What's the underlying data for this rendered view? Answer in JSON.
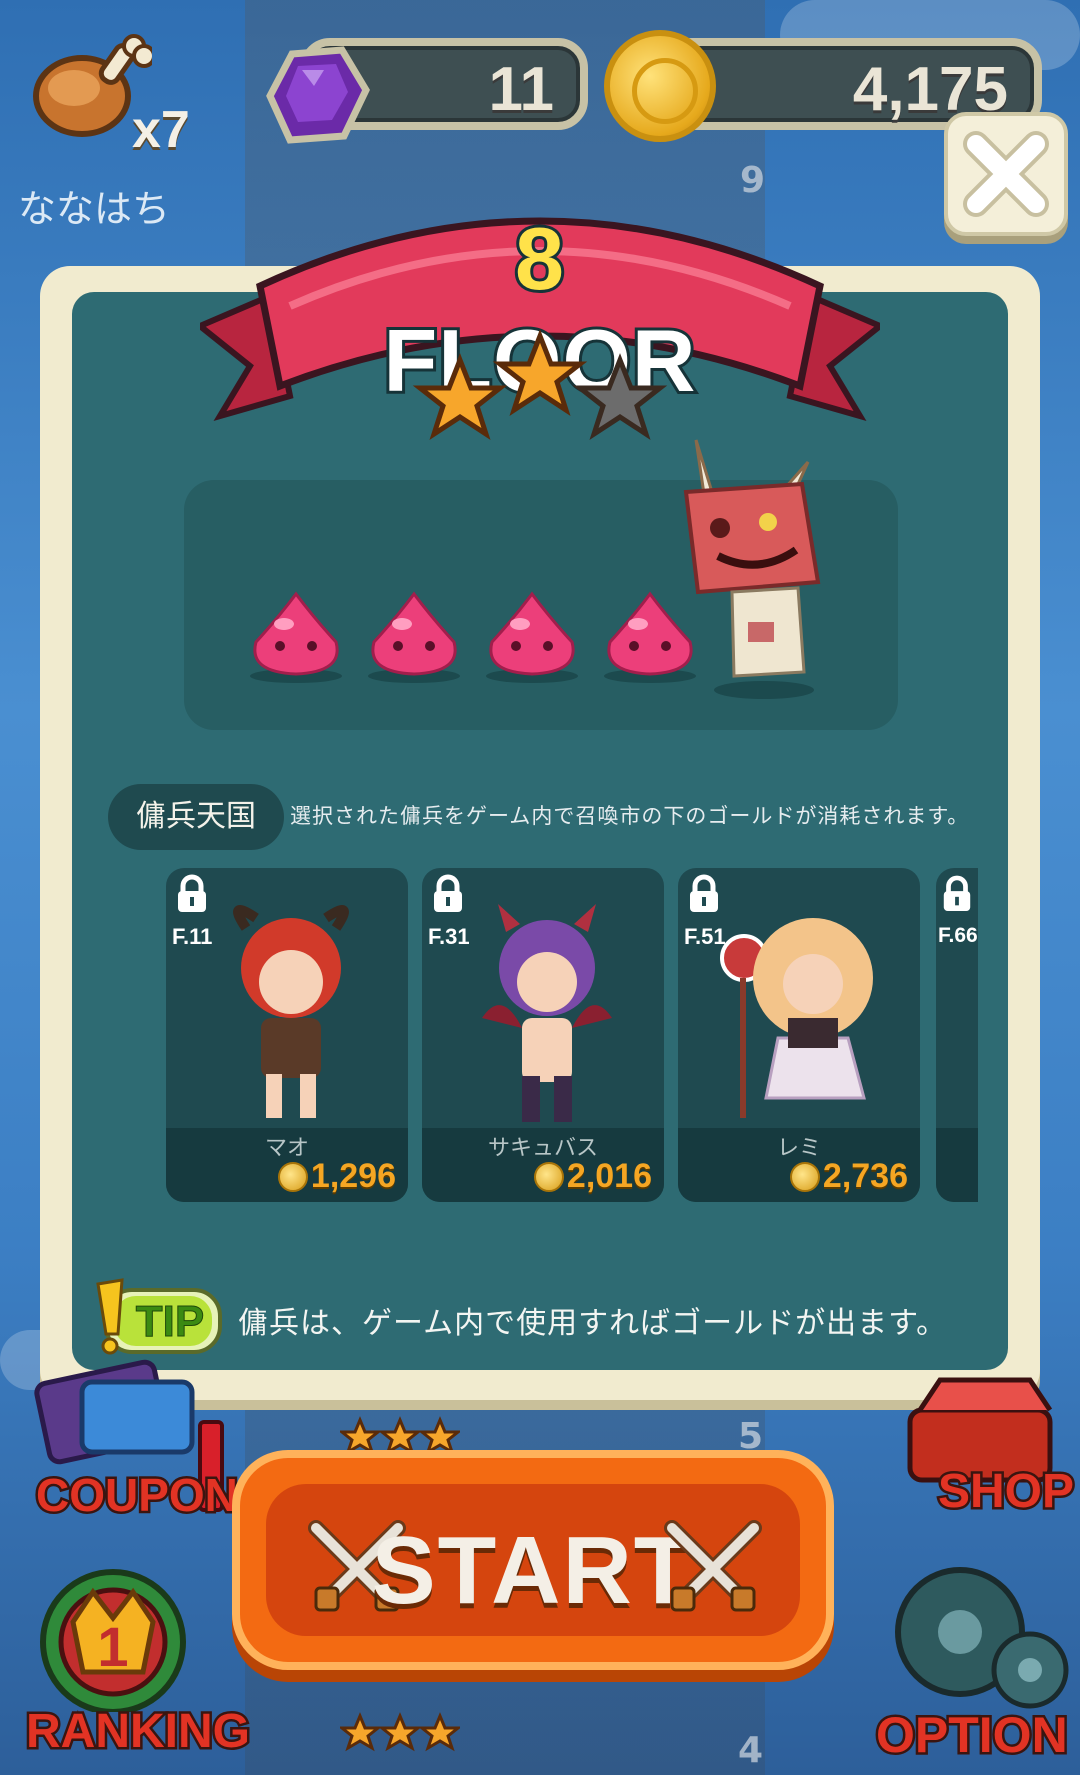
{
  "hud": {
    "meat_count": "x7",
    "player_name": "ななはち",
    "gems": "11",
    "gold": "4,175"
  },
  "background": {
    "floor_numbers": [
      "9",
      "5",
      "4"
    ]
  },
  "banner": {
    "floor_number": "8",
    "floor_label": "FLOOR",
    "stars_earned": 2,
    "stars_total": 3
  },
  "enemies": {
    "slime_count": 4,
    "boss": "boss-rabbit-mask"
  },
  "mercenary": {
    "label": "傭兵天国",
    "description": "選択された傭兵をゲーム内で召喚市の下のゴールドが消耗されます。",
    "cards": [
      {
        "floor": "F.11",
        "name": "マオ",
        "price": "1,296"
      },
      {
        "floor": "F.31",
        "name": "サキュバス",
        "price": "2,016"
      },
      {
        "floor": "F.51",
        "name": "レミ",
        "price": "2,736"
      },
      {
        "floor": "F.66",
        "name": "",
        "price": ""
      }
    ]
  },
  "tip": {
    "badge": "TIP",
    "text": "傭兵は、ゲーム内で使用すればゴールドが出ます。"
  },
  "start": {
    "label": "START"
  },
  "side": {
    "coupon": "COUPON",
    "shop": "SHOP",
    "ranking": "RANKING",
    "option": "OPTION"
  },
  "colors": {
    "panel": "#2e6b73",
    "banner": "#e23a5b",
    "start": "#f36a12",
    "gold_text": "#f5a623"
  }
}
